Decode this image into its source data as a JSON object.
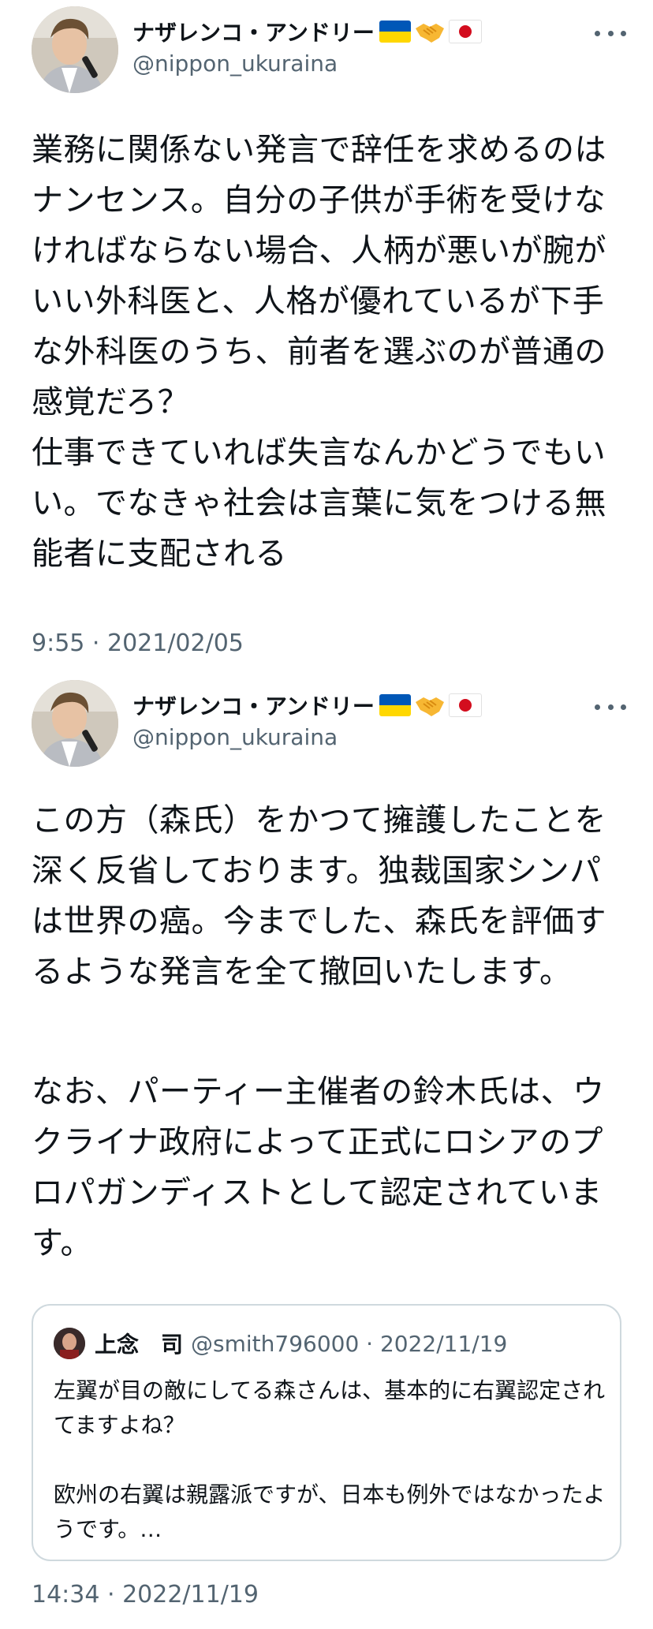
{
  "tweet1": {
    "author_name": "ナザレンコ・アンドリー",
    "handle": "@nippon_ukuraina",
    "icons": [
      "ukraine-flag",
      "handshake",
      "japan-flag",
      "more-options"
    ],
    "text": "業務に関係ない発言で辞任を求めるのはナンセンス。自分の子供が手術を受けなければならない場合、人柄が悪いが腕がいい外科医と、人格が優れているが下手な外科医のうち、前者を選ぶのが普通の感覚だろ？\n仕事できていれば失言なんかどうでもいい。でなきゃ社会は言葉に気をつける無能者に支配される",
    "timestamp": "9:55 · 2021/02/05"
  },
  "tweet2": {
    "author_name": "ナザレンコ・アンドリー",
    "handle": "@nippon_ukuraina",
    "text": "この方（森氏）をかつて擁護したことを深く反省しております。独裁国家シンパは世界の癌。今までした、森氏を評価するような発言を全て撤回いたします。",
    "text2": "なお、パーティー主催者の鈴木氏は、ウクライナ政府によって正式にロシアのプロパガンディストとして認定されています。",
    "quote": {
      "author_name": "上念　司",
      "handle_date": "@smith796000 · 2022/11/19",
      "text": "左翼が目の敵にしてる森さんは、基本的に右翼認定されてますよね？\n\n欧州の右翼は親露派ですが、日本も例外ではなかったようです。…"
    },
    "timestamp": "14:34 · 2022/11/19"
  },
  "colors": {
    "text": "#0f1419",
    "secondary": "#536471",
    "border": "#cfd9de",
    "ua_blue": "#0057b7",
    "ua_yellow": "#ffd700",
    "jp_red": "#d30d1e"
  }
}
